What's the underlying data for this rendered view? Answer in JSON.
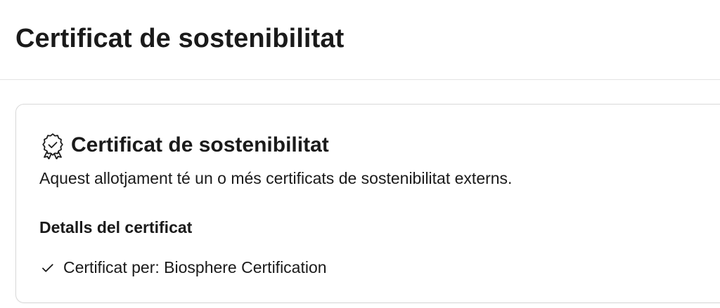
{
  "header": {
    "title": "Certificat de sostenibilitat"
  },
  "card": {
    "icon": "award-badge-icon",
    "title": "Certificat de sostenibilitat",
    "description": "Aquest allotjament té un o més certificats de sostenibilitat externs.",
    "details_title": "Detalls del certificat",
    "details": [
      {
        "icon": "checkmark-icon",
        "text": "Certificat per: Biosphere Certification"
      }
    ]
  }
}
